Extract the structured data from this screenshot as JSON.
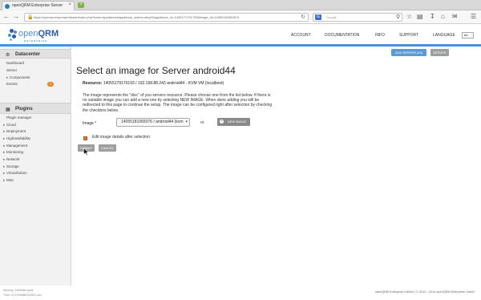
{
  "browser": {
    "tab_title": "openQRM Enterprise Server",
    "tab_close": "×",
    "new_tab": "+",
    "url": "https://openqrm/openqrm/base/index.php?base=appliance&appliance_action=step2&appliance_id=14051717917938image_id=14052181652874",
    "search_placeholder": "Google",
    "search_engine": "G"
  },
  "header": {
    "logo_main": "open",
    "logo_accent": "QRM",
    "logo_sub": "ENTERPRISE",
    "nav": [
      "ACCOUNT",
      "DOCUMENTATION",
      "INFO",
      "SUPPORT"
    ],
    "language_label": "LANGUAGE",
    "language_value": "en"
  },
  "sidebar": {
    "datacenter_title": "Datacenter",
    "datacenter_items": [
      "Dashboard",
      "Server",
      "Components",
      "Events"
    ],
    "events_count": "5",
    "plugins_title": "Plugins",
    "plugin_manager": "Plugin manager",
    "plugin_items": [
      "Cloud",
      "Deployment",
      "Highavailability",
      "Management",
      "Monitoring",
      "Network",
      "Storage",
      "Virtualization",
      "Misc"
    ],
    "memory": "Memory: 1849666 bytes",
    "time": "Time: 0.071296882223511 sec"
  },
  "main": {
    "add_server_label": "ADD SERVER (24)",
    "server_label": "SERVER",
    "title": "Select an image for Server android44",
    "resource_label": "Resource:",
    "resource_value": "14055179176193 / 192.168.88.243 android44 - KVM VM (localboot)",
    "description": "The image represents the \"disc\" of you servers resource. Please choose one from the list below. If there is no suitable image you can add a new one by selecting NEW IMAGE. When done adding you will be redirected to this page to continue the setup. The image can be configured right after selection by checking the checkbox below.",
    "image_label": "Image *",
    "image_selected": "14055181065076 / android44 (kvm",
    "or_label": "or",
    "new_image_label": "NEW IMAGE",
    "edit_checkbox_label": "Edit image details after selection",
    "submit_label": "SUBMIT",
    "cancel_label": "CANCEL"
  },
  "footer": {
    "text": "openQRM Enterprise Edition | © 2012 - 2014 openQRM Enterprise GmbH"
  }
}
